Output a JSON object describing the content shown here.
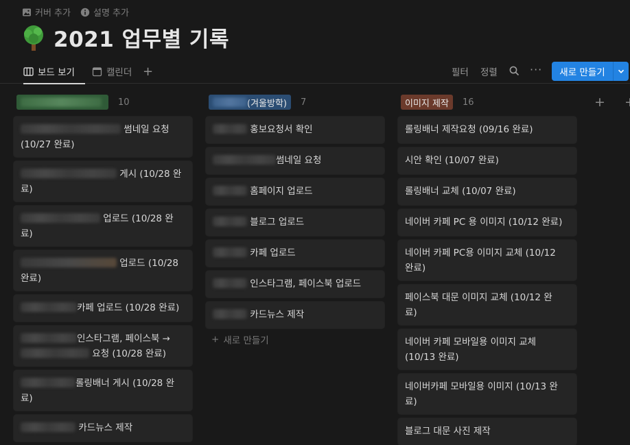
{
  "meta": {
    "add_cover": "커버 추가",
    "add_description": "설명 추가"
  },
  "title": "2021 업무별 기록",
  "views": {
    "tabs": [
      {
        "label": "보드 보기",
        "active": true
      },
      {
        "label": "캘린더",
        "active": false
      }
    ],
    "add": "+",
    "filter": "필터",
    "sort": "정렬",
    "more": "···",
    "new_button": "새로 만들기"
  },
  "columns": [
    {
      "tag": "",
      "tag_color": "#2f5a37",
      "count": "10",
      "cards": [
        {
          "text": "썸네일 요청",
          "text2": "(10/27 완료)"
        },
        {
          "text": "게시 (10/28 완",
          "text2": "료)"
        },
        {
          "text": "업로드 (10/28 완",
          "text2": "료)"
        },
        {
          "text": "업로드 (10/28",
          "text2": "완료)"
        },
        {
          "text": "카페 업로드 (10/28 완료)"
        },
        {
          "text": "인스타그램, 페이스북 →",
          "text2": "요청 (10/28 완료)"
        },
        {
          "text": "롤링배너 게시 (10/28 완",
          "text2": "료)"
        },
        {
          "text": "카드뉴스 제작"
        }
      ]
    },
    {
      "tag": "(겨울방학)",
      "tag_color": "#2b4d73",
      "count": "7",
      "cards": [
        {
          "text": "홍보요청서 확인"
        },
        {
          "text": "썸네일 요청"
        },
        {
          "text": "홈페이지 업로드"
        },
        {
          "text": "블로그 업로드"
        },
        {
          "text": "카페 업로드"
        },
        {
          "text": "인스타그램, 페이스북 업로드"
        },
        {
          "text": "카드뉴스 제작"
        }
      ],
      "new_item": "새로 만들기"
    },
    {
      "tag": "이미지 제작",
      "tag_color": "#6b3a2b",
      "count": "16",
      "cards": [
        {
          "text": "롤링배너 제작요청 (09/16 완료)"
        },
        {
          "text": "시안 확인 (10/07 완료)"
        },
        {
          "text": "롤링배너 교체 (10/07 완료)"
        },
        {
          "text": "네이버 카페 PC 용 이미지 (10/12 완료)"
        },
        {
          "text": "네이버 카페 PC용 이미지 교체 (10/12",
          "text2": "완료)"
        },
        {
          "text": "페이스북 대문 이미지 교체 (10/12 완",
          "text2": "료)"
        },
        {
          "text": "네이버 카페 모바일용 이미지 교체",
          "text2": "(10/13 완료)"
        },
        {
          "text": "네이버카페 모바일용 이미지 (10/13 완",
          "text2": "료)"
        },
        {
          "text": "블로그 대문 사진 제작"
        }
      ]
    }
  ]
}
